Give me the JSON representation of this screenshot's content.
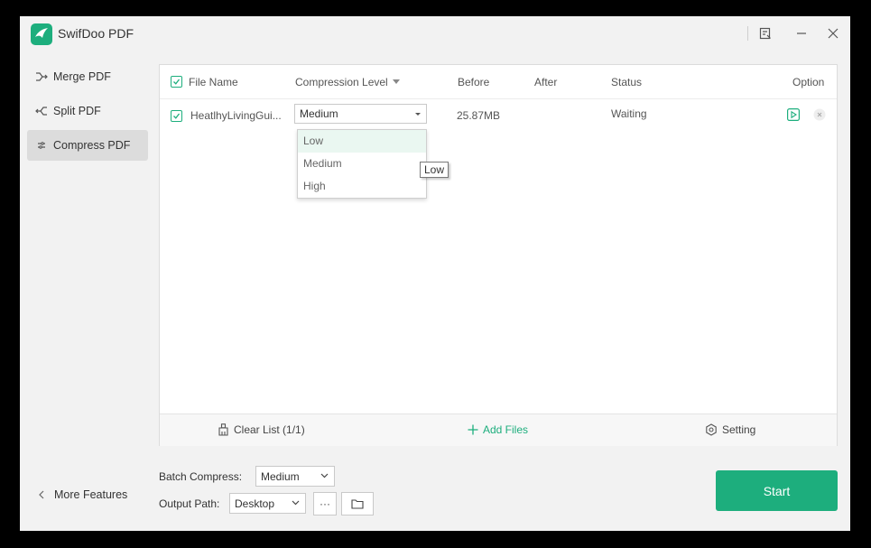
{
  "app": {
    "title": "SwifDoo PDF"
  },
  "sidebar": {
    "items": [
      {
        "label": "Merge PDF",
        "icon": "merge-icon"
      },
      {
        "label": "Split PDF",
        "icon": "split-icon"
      },
      {
        "label": "Compress PDF",
        "icon": "compress-icon",
        "active": true
      }
    ],
    "more_features": "More Features"
  },
  "table": {
    "headers": {
      "file_name": "File Name",
      "compression_level": "Compression Level",
      "before": "Before",
      "after": "After",
      "status": "Status",
      "option": "Option"
    },
    "rows": [
      {
        "file_name": "Heatlhy​Living​Gui...",
        "compression_level": "Medium",
        "before": "25.87MB",
        "after": "",
        "status": "Waiting"
      }
    ]
  },
  "dropdown": {
    "options": [
      "Low",
      "Medium",
      "High"
    ],
    "highlighted": "Low",
    "tooltip": "Low"
  },
  "footer": {
    "clear_list": "Clear List (1/1)",
    "add_files": "Add Files",
    "setting": "Setting"
  },
  "bottom": {
    "batch_compress_label": "Batch Compress:",
    "batch_compress_value": "Medium",
    "output_path_label": "Output Path:",
    "output_path_value": "Desktop",
    "more_button": "···",
    "start": "Start"
  },
  "colors": {
    "accent": "#1dae7d",
    "window_bg": "#f2f2f2",
    "sidebar_active": "#dcdcdc"
  }
}
